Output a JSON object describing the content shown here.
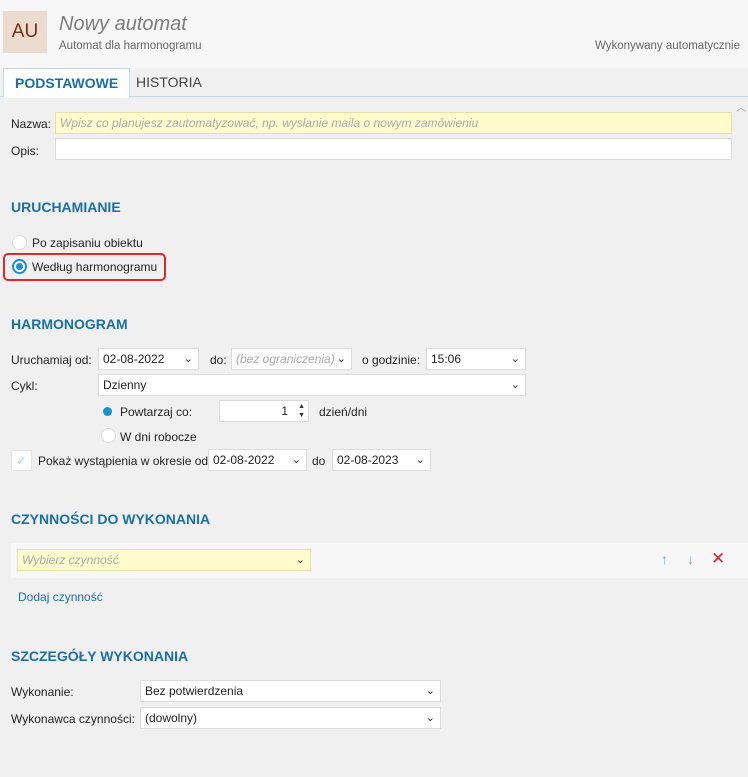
{
  "header": {
    "avatar": "AU",
    "title": "Nowy automat",
    "subtitle": "Automat dla harmonogramu",
    "run_mode": "Wykonywany automatycznie"
  },
  "tabs": [
    {
      "label": "PODSTAWOWE",
      "active": true
    },
    {
      "label": "HISTORIA",
      "active": false
    }
  ],
  "form": {
    "name_label": "Nazwa:",
    "name_placeholder": "Wpisz co planujesz zautomatyzować, np. wysłanie maila o nowym zamówieniu",
    "desc_label": "Opis:",
    "desc_value": ""
  },
  "launch": {
    "section": "URUCHAMIANIE",
    "options": [
      {
        "label": "Po zapisaniu obiektu",
        "checked": false
      },
      {
        "label": "Według harmonogramu",
        "checked": true
      }
    ]
  },
  "schedule": {
    "section": "HARMONOGRAM",
    "run_from_label": "Uruchamiaj od:",
    "run_from": "02-08-2022",
    "to_label": "do:",
    "to_placeholder": "(bez ograniczenia)",
    "time_label": "o godzinie:",
    "time": "15:06",
    "cycle_label": "Cykl:",
    "cycle": "Dzienny",
    "repeat_label": "Powtarzaj co:",
    "repeat_value": "1",
    "repeat_unit": "dzień/dni",
    "workdays_label": "W dni robocze",
    "show_label": "Pokaż wystąpienia w okresie od",
    "show_from": "02-08-2022",
    "show_to_label": "do",
    "show_to": "02-08-2023"
  },
  "actions": {
    "section": "CZYNNOŚCI DO WYKONANIA",
    "select_placeholder": "Wybierz czynność",
    "add_link": "Dodaj czynność"
  },
  "details": {
    "section": "SZCZEGÓŁY WYKONANIA",
    "execution_label": "Wykonanie:",
    "execution": "Bez potwierdzenia",
    "executor_label": "Wykonawca czynności:",
    "executor": "(dowolny)"
  },
  "colors": {
    "accent": "#1a6fa6",
    "highlight": "#e0282e",
    "field_yellow": "#fffbcc"
  }
}
